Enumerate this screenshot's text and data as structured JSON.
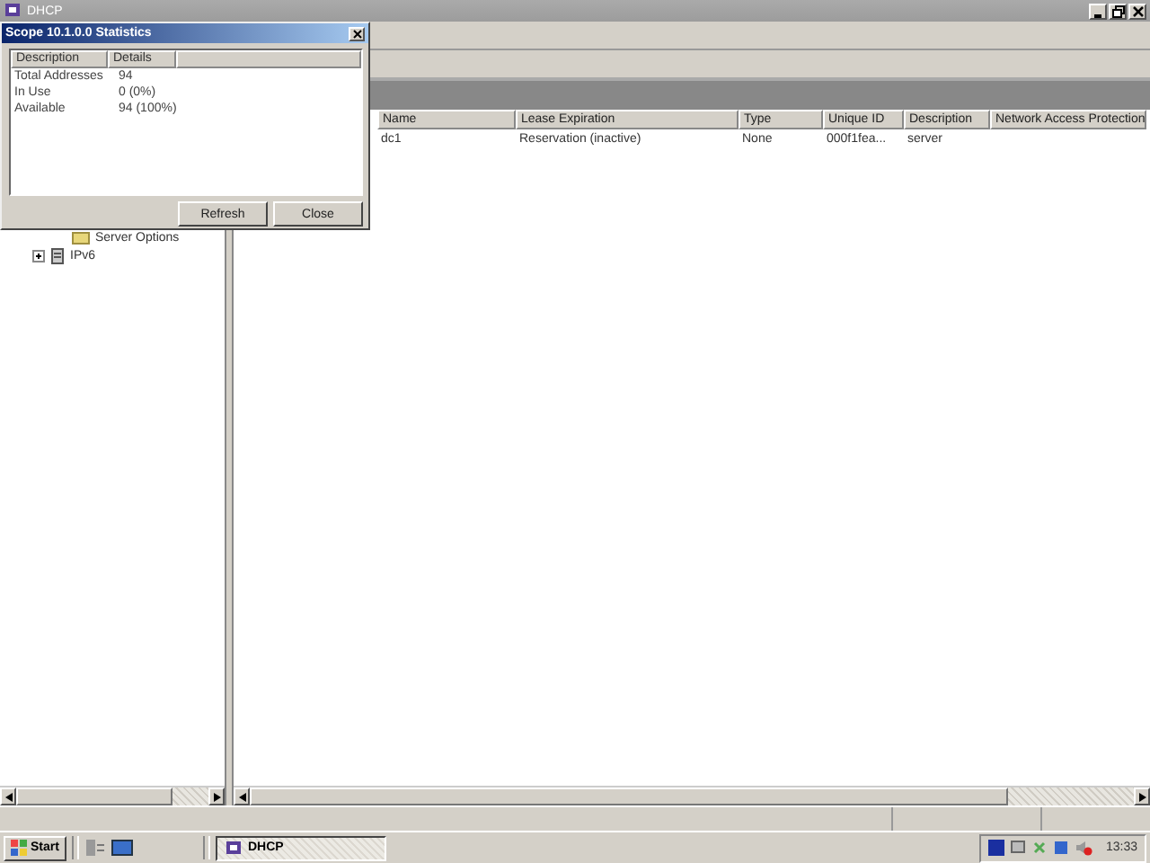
{
  "window": {
    "title": "DHCP"
  },
  "tree": {
    "items": [
      {
        "label": "Server Options",
        "kind": "folder"
      },
      {
        "label": "IPv6",
        "kind": "server"
      }
    ]
  },
  "list": {
    "columns": [
      "Name",
      "Lease Expiration",
      "Type",
      "Unique ID",
      "Description",
      "Network Access Protection"
    ],
    "rows": [
      [
        "dc1",
        "Reservation (inactive)",
        "None",
        "000f1fea...",
        "server",
        ""
      ]
    ]
  },
  "dialog": {
    "title": "Scope 10.1.0.0 Statistics",
    "columns": [
      "Description",
      "Details"
    ],
    "rows": [
      [
        "Total Addresses",
        "94"
      ],
      [
        "In Use",
        "0 (0%)"
      ],
      [
        "Available",
        "94 (100%)"
      ]
    ],
    "buttons": [
      "Refresh",
      "Close"
    ]
  },
  "taskbar": {
    "start": "Start",
    "tasks": [
      {
        "label": "DHCP",
        "selected": true
      }
    ],
    "clock": "13:33"
  }
}
